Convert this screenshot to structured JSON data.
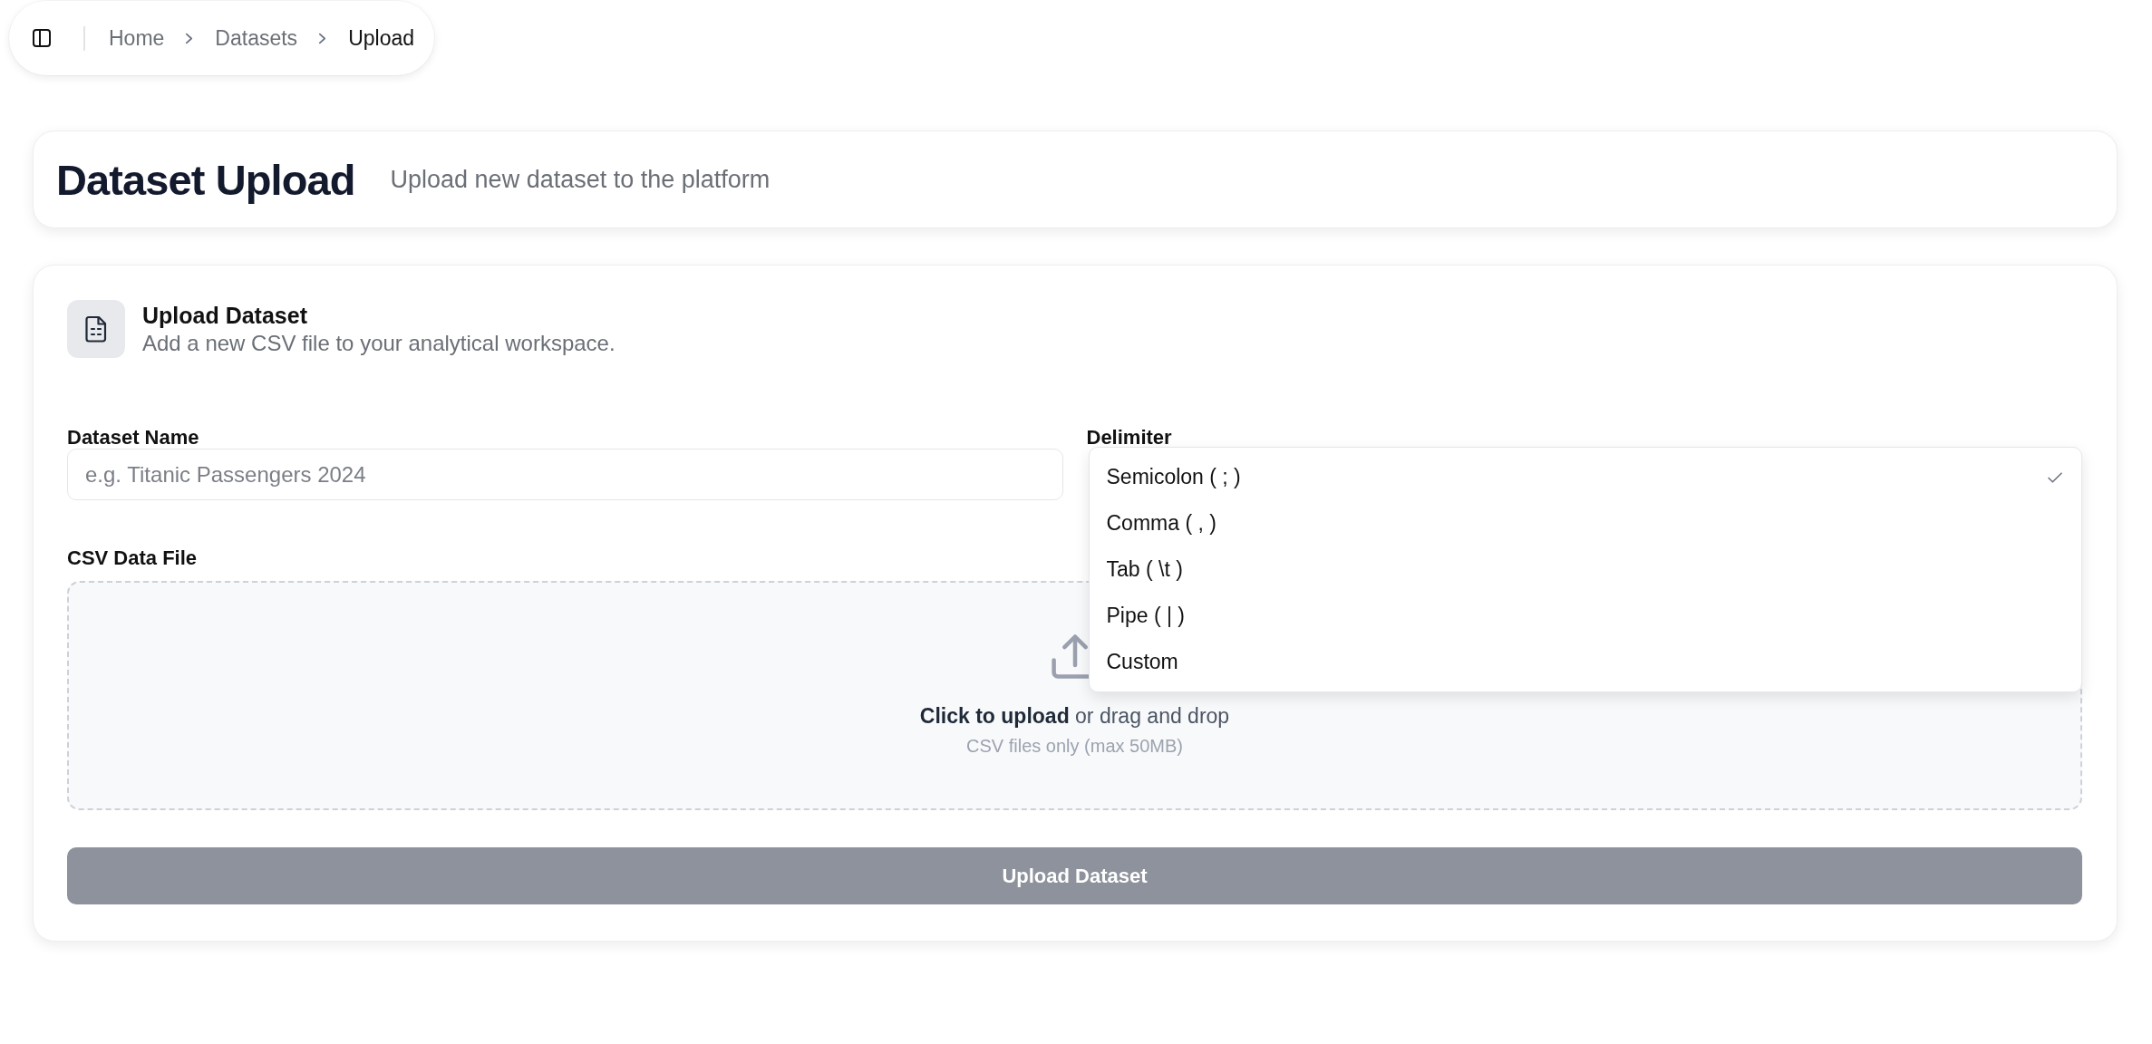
{
  "breadcrumb": {
    "items": [
      {
        "label": "Home",
        "current": false
      },
      {
        "label": "Datasets",
        "current": false
      },
      {
        "label": "Upload",
        "current": true
      }
    ]
  },
  "header": {
    "title": "Dataset Upload",
    "subtitle": "Upload new dataset to the platform"
  },
  "upload_card": {
    "title": "Upload Dataset",
    "subtitle": "Add a new CSV file to your analytical workspace.",
    "fields": [
      {
        "kind": "text",
        "label": "Dataset Name",
        "placeholder": "e.g. Titanic Passengers 2024"
      },
      {
        "kind": "select",
        "label": "Delimiter",
        "expanded": true,
        "options": [
          {
            "label": "Semicolon ( ; )",
            "selected": true
          },
          {
            "label": "Comma ( , )",
            "selected": false
          },
          {
            "label": "Tab ( \\t )",
            "selected": false
          },
          {
            "label": "Pipe ( | )",
            "selected": false
          },
          {
            "label": "Custom",
            "selected": false
          }
        ]
      }
    ],
    "file_field": {
      "label": "CSV Data File",
      "prompt": "**Click to upload** or drag and drop",
      "hint": "CSV files only (max 50MB)"
    },
    "submit": {
      "label": "Upload Dataset",
      "disabled": true
    }
  }
}
